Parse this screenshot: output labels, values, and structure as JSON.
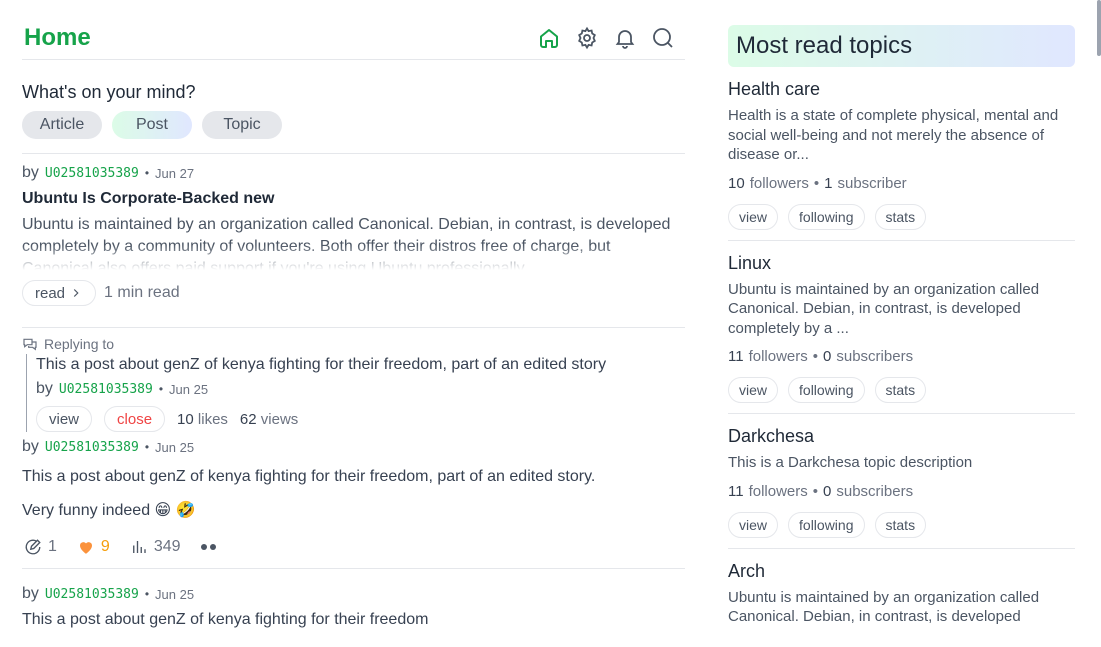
{
  "header": {
    "title": "Home",
    "icons": [
      "home-icon",
      "gear-icon",
      "bell-icon",
      "search-icon"
    ],
    "active_color": "#16a34a"
  },
  "composer": {
    "question": "What's on your mind?",
    "tabs": [
      {
        "label": "Article"
      },
      {
        "label": "Post"
      },
      {
        "label": "Topic"
      }
    ]
  },
  "feed": {
    "article": {
      "by": "by",
      "user": "U02581035389",
      "date": "Jun 27",
      "title": "Ubuntu Is Corporate-Backed new",
      "body": "Ubuntu is maintained by an organization called Canonical. Debian, in contrast, is developed completely by a community of volunteers. Both offer their distros free of charge, but Canonical also offers paid support if you're using Ubuntu professionally...",
      "read_label": "read",
      "read_time": "1 min read"
    },
    "reply": {
      "replying_to": "Replying to",
      "text": "This a post about genZ of kenya fighting for their freedom, part of an edited story",
      "by": "by",
      "user": "U02581035389",
      "date": "Jun 25",
      "view_label": "view",
      "close_label": "close",
      "likes_count": "10",
      "likes_label": "likes",
      "views_count": "62",
      "views_label": "views"
    },
    "post": {
      "by": "by",
      "user": "U02581035389",
      "date": "Jun 25",
      "text": "This a post about genZ of kenya fighting for their freedom, part of an edited story.",
      "sub": "Very funny indeed 😁 🤣",
      "replies": "1",
      "likes": "9",
      "views": "349"
    },
    "post2": {
      "by": "by",
      "user": "U02581035389",
      "date": "Jun 25",
      "text": "This a post about genZ of kenya fighting for their freedom"
    }
  },
  "sidebar": {
    "title": "Most read topics",
    "topics": [
      {
        "name": "Health care",
        "desc": "Health is a state of complete physical, mental and social well-being and not merely the absence of disease or...",
        "followers": "10",
        "followers_label": "followers",
        "subs": "1",
        "subs_label": "subscriber"
      },
      {
        "name": "Linux",
        "desc": "Ubuntu is maintained by an organization called Canonical. Debian, in contrast, is developed completely by a ...",
        "followers": "11",
        "followers_label": "followers",
        "subs": "0",
        "subs_label": "subscribers"
      },
      {
        "name": "Darkchesa",
        "desc": "This is a Darkchesa topic description",
        "followers": "11",
        "followers_label": "followers",
        "subs": "0",
        "subs_label": "subscribers"
      },
      {
        "name": "Arch",
        "desc": "Ubuntu is maintained by an organization called Canonical. Debian, in contrast, is developed",
        "followers": "",
        "followers_label": "",
        "subs": "",
        "subs_label": ""
      }
    ],
    "actions": {
      "view": "view",
      "following": "following",
      "stats": "stats"
    },
    "sep": "•"
  }
}
